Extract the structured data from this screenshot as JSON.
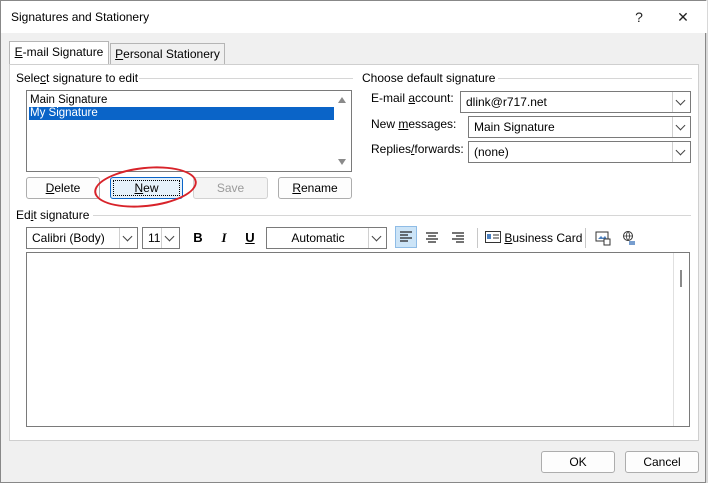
{
  "window": {
    "title": "Signatures and Stationery",
    "help": "?",
    "close": "✕"
  },
  "tabs": [
    {
      "label": "E-mail Signature",
      "mnemonic": "E",
      "rest": "-mail Signature"
    },
    {
      "label": "Personal Stationery",
      "mnemonic": "P",
      "rest": "ersonal Stationery"
    }
  ],
  "select_section": {
    "label_pre": "Sele",
    "label_mn": "c",
    "label_post": "t signature to edit",
    "items": [
      {
        "label": "Main Signature",
        "selected": false
      },
      {
        "label": "My Signature",
        "selected": true
      }
    ]
  },
  "buttons": {
    "delete_mn": "D",
    "delete_rest": "elete",
    "new_mn": "N",
    "new_rest": "ew",
    "save": "Save",
    "rename_mn": "R",
    "rename_rest": "ename"
  },
  "defaults": {
    "title": "Choose default signature",
    "email_label_pre": "E-mail ",
    "email_label_mn": "a",
    "email_label_post": "ccount:",
    "email_value": "dlink@r717.net",
    "new_label_pre": "New ",
    "new_label_mn": "m",
    "new_label_post": "essages:",
    "new_value": "Main Signature",
    "replies_label_pre": "Replies",
    "replies_label_mn": "/",
    "replies_label_post": "forwards:",
    "replies_value": "(none)"
  },
  "edit_section": {
    "label_pre": "Ed",
    "label_mn": "i",
    "label_post": "t signature",
    "font": "Calibri (Body)",
    "size": "11",
    "bold": "B",
    "italic": "I",
    "underline": "U",
    "color": "Automatic",
    "business_card_mn": "B",
    "business_card_rest": "usiness Card"
  },
  "footer": {
    "ok": "OK",
    "cancel": "Cancel"
  },
  "colors": {
    "selection": "#0a64c8",
    "annotation": "#d8232a"
  },
  "icons": [
    "help-icon",
    "close-icon",
    "scroll-up-icon",
    "scroll-down-icon",
    "chevron-down-icon",
    "align-left-icon",
    "align-center-icon",
    "align-right-icon",
    "business-card-icon",
    "insert-picture-icon",
    "hyperlink-icon"
  ]
}
